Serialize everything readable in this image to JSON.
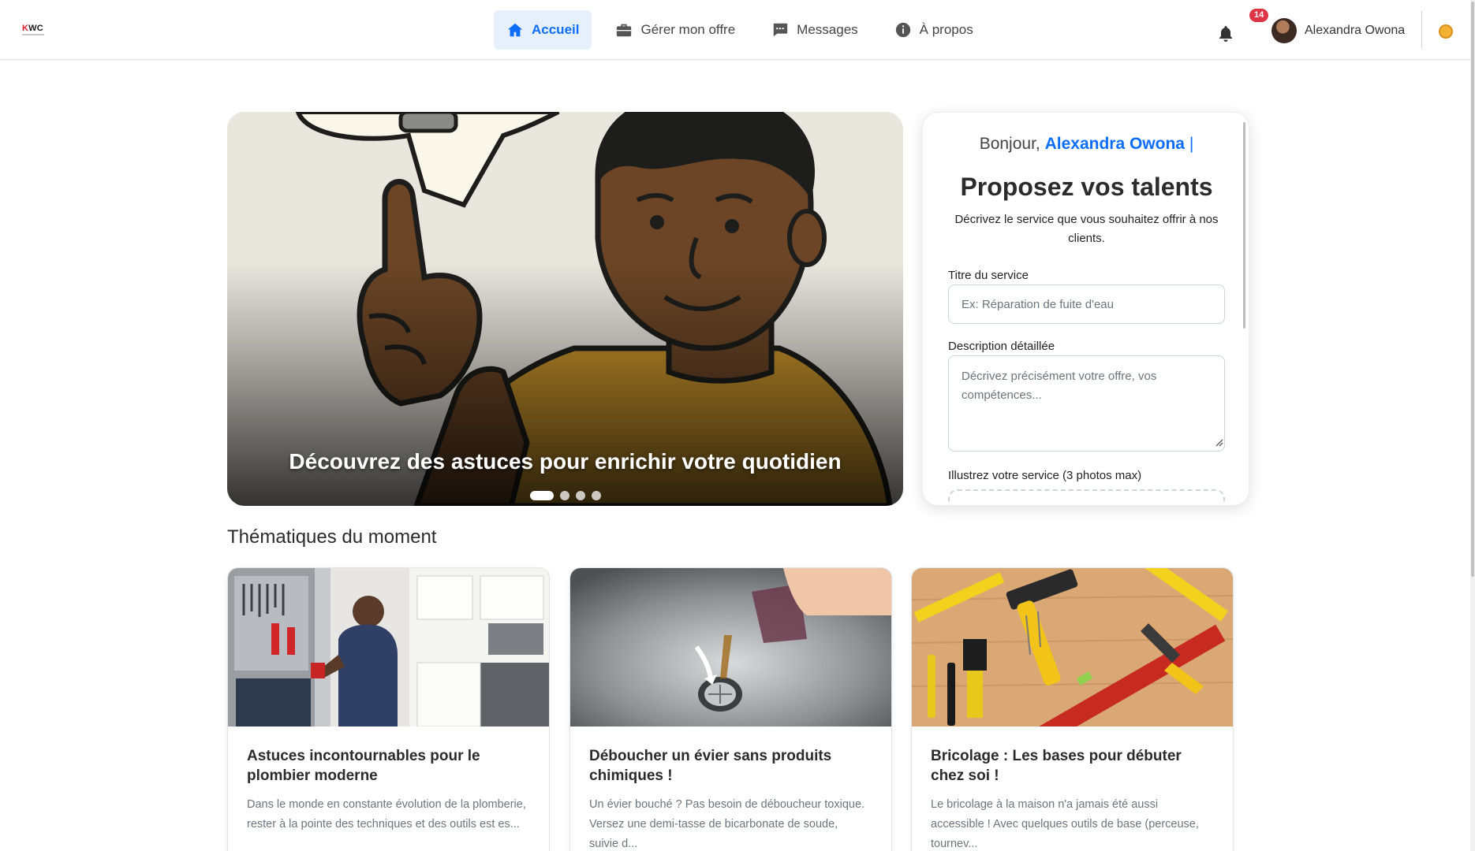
{
  "brand": {
    "logo_k": "K",
    "logo_rest": "WC"
  },
  "nav": {
    "items": [
      {
        "label": "Accueil",
        "icon": "home-icon",
        "active": true
      },
      {
        "label": "Gérer mon offre",
        "icon": "briefcase-icon",
        "active": false
      },
      {
        "label": "Messages",
        "icon": "chat-icon",
        "active": false
      },
      {
        "label": "À propos",
        "icon": "info-icon",
        "active": false
      }
    ],
    "notifications_count": "14",
    "user_name": "Alexandra Owona"
  },
  "hero": {
    "caption": "Découvrez des astuces pour enrichir votre quotidien",
    "slides_count": 4,
    "active_slide": 1
  },
  "form": {
    "greeting_prefix": "Bonjour,",
    "greeting_name": "Alexandra Owona",
    "greeting_caret": "|",
    "title": "Proposez vos talents",
    "subtitle": "Décrivez le service que vous souhaitez offrir à nos clients.",
    "service_title_label": "Titre du service",
    "service_title_placeholder": "Ex: Réparation de fuite d'eau",
    "description_label": "Description détaillée",
    "description_placeholder": "Décrivez précisément votre offre, vos compétences...",
    "photos_label": "Illustrez votre service (3 photos max)"
  },
  "section": {
    "title": "Thématiques du moment",
    "cards": [
      {
        "title": "Astuces incontournables pour le plombier moderne",
        "excerpt": "Dans le monde en constante évolution de la plomberie, rester à la pointe des techniques et des outils est es..."
      },
      {
        "title": "Déboucher un évier sans produits chimiques !",
        "excerpt": "Un évier bouché ? Pas besoin de déboucheur toxique. Versez une demi-tasse de bicarbonate de soude, suivie d..."
      },
      {
        "title": "Bricolage : Les bases pour débuter chez soi !",
        "excerpt": "Le bricolage à la maison n'a jamais été aussi accessible ! Avec quelques outils de base (perceuse, tournev..."
      }
    ]
  },
  "colors": {
    "primary": "#0d6efd",
    "active_bg": "#e6f0fb",
    "badge": "#dc3545",
    "logo_red": "#e11d2a"
  }
}
